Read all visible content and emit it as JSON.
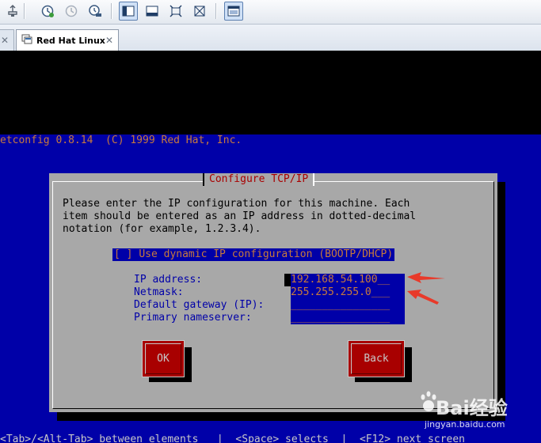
{
  "host": {
    "toolbar": {
      "buttons": [
        {
          "name": "usb-plug-icon"
        },
        {
          "name": "snapshot-take-icon"
        },
        {
          "name": "snapshot-revert-icon"
        },
        {
          "name": "snapshot-manager-icon"
        },
        {
          "name": "show-library-icon",
          "active": true
        },
        {
          "name": "thumbnail-bar-icon"
        },
        {
          "name": "full-screen-icon"
        },
        {
          "name": "unity-icon"
        },
        {
          "name": "console-view-icon",
          "active": true
        }
      ]
    },
    "tabs": [
      {
        "label": "",
        "close": "✕"
      },
      {
        "label": "Red Hat Linux",
        "close": "✕",
        "active": true
      }
    ]
  },
  "guest": {
    "header": "etconfig 0.8.14  (C) 1999 Red Hat, Inc.",
    "footer": "<Tab>/<Alt-Tab> between elements   |  <Space> selects  |  <F12> next screen",
    "dialog": {
      "title": "Configure TCP/IP",
      "message": [
        "Please enter the IP configuration for this machine. Each",
        "item should be entered as an IP address in dotted-decimal",
        "notation (for example, 1.2.3.4)."
      ],
      "dhcp": {
        "checkbox": "[ ]",
        "label": "Use dynamic IP configuration (BOOTP/DHCP)"
      },
      "fields": [
        {
          "label": "IP address:",
          "value": "192.168.54.100__"
        },
        {
          "label": "Netmask:",
          "value": "255.255.255.0___"
        },
        {
          "label": "Default gateway (IP):",
          "value": "________________"
        },
        {
          "label": "Primary nameserver:",
          "value": "________________"
        }
      ],
      "buttons": {
        "ok": "OK",
        "back": "Back"
      }
    }
  },
  "colors": {
    "guest_bg": "#0000a8",
    "dialog_bg": "#a8a8a8",
    "title": "#a80000",
    "input_text": "#c87a3c",
    "button_bg": "#a80000",
    "arrow": "#e83a2a"
  },
  "watermark": {
    "brand": "Bai经验",
    "url": "jingyan.baidu.com"
  }
}
